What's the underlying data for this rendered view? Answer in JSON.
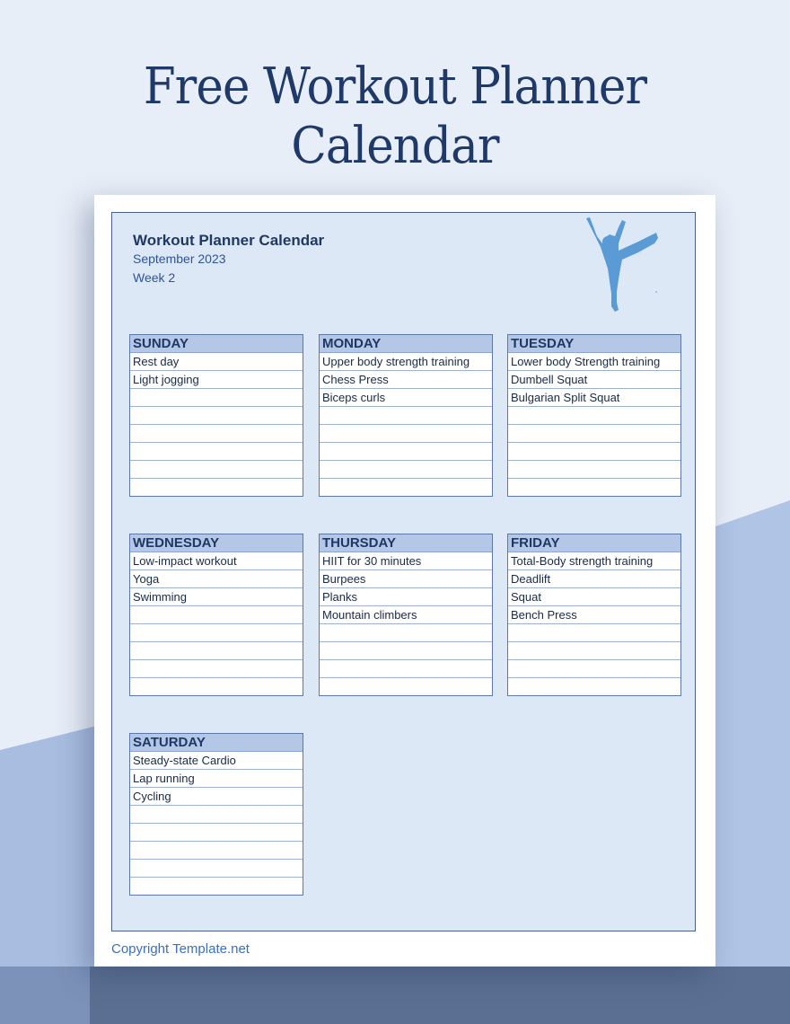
{
  "hero": {
    "title_line1": "Free Workout Planner",
    "title_line2": "Calendar"
  },
  "planner": {
    "title": "Workout Planner Calendar",
    "month": "September 2023",
    "week": "Week 2",
    "illustration": "dancer-silhouette-icon"
  },
  "days": [
    {
      "name": "SUNDAY",
      "items": [
        "Rest day",
        "Light jogging",
        "",
        "",
        "",
        "",
        "",
        ""
      ]
    },
    {
      "name": "MONDAY",
      "items": [
        "Upper body strength training",
        "Chess Press",
        "Biceps curls",
        "",
        "",
        "",
        "",
        ""
      ]
    },
    {
      "name": "TUESDAY",
      "items": [
        "Lower body Strength training",
        "Dumbell Squat",
        "Bulgarian Split Squat",
        "",
        "",
        "",
        "",
        ""
      ]
    },
    {
      "name": "WEDNESDAY",
      "items": [
        "Low-impact workout",
        "Yoga",
        "Swimming",
        "",
        "",
        "",
        "",
        ""
      ]
    },
    {
      "name": "THURSDAY",
      "items": [
        "HIIT for 30 minutes",
        "Burpees",
        "Planks",
        "Mountain climbers",
        "",
        "",
        "",
        ""
      ]
    },
    {
      "name": "FRIDAY",
      "items": [
        "Total-Body strength training",
        "Deadlift",
        "Squat",
        "Bench Press",
        "",
        "",
        "",
        ""
      ]
    },
    {
      "name": "SATURDAY",
      "items": [
        "Steady-state Cardio",
        "Lap running",
        "Cycling",
        "",
        "",
        "",
        "",
        ""
      ]
    }
  ],
  "footer": {
    "copyright": "Copyright Template.net"
  },
  "colors": {
    "background": "#e8eef8",
    "accent_shape": "#b0c4e6",
    "title": "#1f3a68",
    "header_fill": "#b4c7e7",
    "panel_fill": "#dde8f6",
    "figure": "#5b9bd5"
  }
}
